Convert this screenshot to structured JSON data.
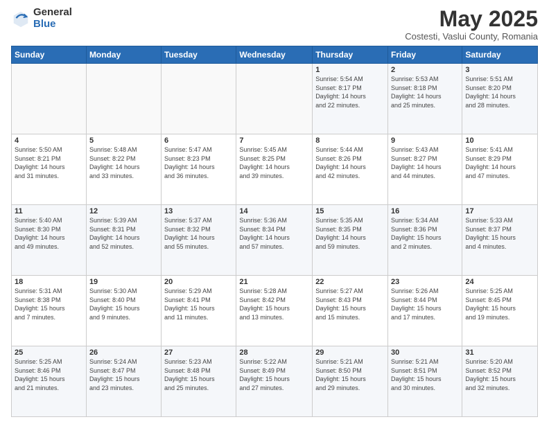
{
  "header": {
    "logo_general": "General",
    "logo_blue": "Blue",
    "month_title": "May 2025",
    "location": "Costesti, Vaslui County, Romania"
  },
  "days_of_week": [
    "Sunday",
    "Monday",
    "Tuesday",
    "Wednesday",
    "Thursday",
    "Friday",
    "Saturday"
  ],
  "weeks": [
    [
      {
        "num": "",
        "info": ""
      },
      {
        "num": "",
        "info": ""
      },
      {
        "num": "",
        "info": ""
      },
      {
        "num": "",
        "info": ""
      },
      {
        "num": "1",
        "info": "Sunrise: 5:54 AM\nSunset: 8:17 PM\nDaylight: 14 hours\nand 22 minutes."
      },
      {
        "num": "2",
        "info": "Sunrise: 5:53 AM\nSunset: 8:18 PM\nDaylight: 14 hours\nand 25 minutes."
      },
      {
        "num": "3",
        "info": "Sunrise: 5:51 AM\nSunset: 8:20 PM\nDaylight: 14 hours\nand 28 minutes."
      }
    ],
    [
      {
        "num": "4",
        "info": "Sunrise: 5:50 AM\nSunset: 8:21 PM\nDaylight: 14 hours\nand 31 minutes."
      },
      {
        "num": "5",
        "info": "Sunrise: 5:48 AM\nSunset: 8:22 PM\nDaylight: 14 hours\nand 33 minutes."
      },
      {
        "num": "6",
        "info": "Sunrise: 5:47 AM\nSunset: 8:23 PM\nDaylight: 14 hours\nand 36 minutes."
      },
      {
        "num": "7",
        "info": "Sunrise: 5:45 AM\nSunset: 8:25 PM\nDaylight: 14 hours\nand 39 minutes."
      },
      {
        "num": "8",
        "info": "Sunrise: 5:44 AM\nSunset: 8:26 PM\nDaylight: 14 hours\nand 42 minutes."
      },
      {
        "num": "9",
        "info": "Sunrise: 5:43 AM\nSunset: 8:27 PM\nDaylight: 14 hours\nand 44 minutes."
      },
      {
        "num": "10",
        "info": "Sunrise: 5:41 AM\nSunset: 8:29 PM\nDaylight: 14 hours\nand 47 minutes."
      }
    ],
    [
      {
        "num": "11",
        "info": "Sunrise: 5:40 AM\nSunset: 8:30 PM\nDaylight: 14 hours\nand 49 minutes."
      },
      {
        "num": "12",
        "info": "Sunrise: 5:39 AM\nSunset: 8:31 PM\nDaylight: 14 hours\nand 52 minutes."
      },
      {
        "num": "13",
        "info": "Sunrise: 5:37 AM\nSunset: 8:32 PM\nDaylight: 14 hours\nand 55 minutes."
      },
      {
        "num": "14",
        "info": "Sunrise: 5:36 AM\nSunset: 8:34 PM\nDaylight: 14 hours\nand 57 minutes."
      },
      {
        "num": "15",
        "info": "Sunrise: 5:35 AM\nSunset: 8:35 PM\nDaylight: 14 hours\nand 59 minutes."
      },
      {
        "num": "16",
        "info": "Sunrise: 5:34 AM\nSunset: 8:36 PM\nDaylight: 15 hours\nand 2 minutes."
      },
      {
        "num": "17",
        "info": "Sunrise: 5:33 AM\nSunset: 8:37 PM\nDaylight: 15 hours\nand 4 minutes."
      }
    ],
    [
      {
        "num": "18",
        "info": "Sunrise: 5:31 AM\nSunset: 8:38 PM\nDaylight: 15 hours\nand 7 minutes."
      },
      {
        "num": "19",
        "info": "Sunrise: 5:30 AM\nSunset: 8:40 PM\nDaylight: 15 hours\nand 9 minutes."
      },
      {
        "num": "20",
        "info": "Sunrise: 5:29 AM\nSunset: 8:41 PM\nDaylight: 15 hours\nand 11 minutes."
      },
      {
        "num": "21",
        "info": "Sunrise: 5:28 AM\nSunset: 8:42 PM\nDaylight: 15 hours\nand 13 minutes."
      },
      {
        "num": "22",
        "info": "Sunrise: 5:27 AM\nSunset: 8:43 PM\nDaylight: 15 hours\nand 15 minutes."
      },
      {
        "num": "23",
        "info": "Sunrise: 5:26 AM\nSunset: 8:44 PM\nDaylight: 15 hours\nand 17 minutes."
      },
      {
        "num": "24",
        "info": "Sunrise: 5:25 AM\nSunset: 8:45 PM\nDaylight: 15 hours\nand 19 minutes."
      }
    ],
    [
      {
        "num": "25",
        "info": "Sunrise: 5:25 AM\nSunset: 8:46 PM\nDaylight: 15 hours\nand 21 minutes."
      },
      {
        "num": "26",
        "info": "Sunrise: 5:24 AM\nSunset: 8:47 PM\nDaylight: 15 hours\nand 23 minutes."
      },
      {
        "num": "27",
        "info": "Sunrise: 5:23 AM\nSunset: 8:48 PM\nDaylight: 15 hours\nand 25 minutes."
      },
      {
        "num": "28",
        "info": "Sunrise: 5:22 AM\nSunset: 8:49 PM\nDaylight: 15 hours\nand 27 minutes."
      },
      {
        "num": "29",
        "info": "Sunrise: 5:21 AM\nSunset: 8:50 PM\nDaylight: 15 hours\nand 29 minutes."
      },
      {
        "num": "30",
        "info": "Sunrise: 5:21 AM\nSunset: 8:51 PM\nDaylight: 15 hours\nand 30 minutes."
      },
      {
        "num": "31",
        "info": "Sunrise: 5:20 AM\nSunset: 8:52 PM\nDaylight: 15 hours\nand 32 minutes."
      }
    ]
  ]
}
